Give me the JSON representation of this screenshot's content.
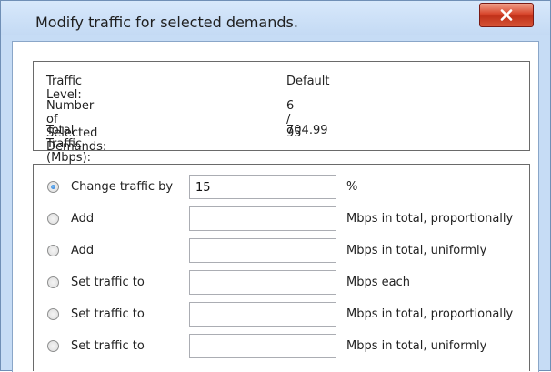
{
  "window": {
    "title": "Modify traffic for selected demands."
  },
  "info": [
    {
      "label": "Traffic Level:",
      "value": "Default"
    },
    {
      "label": "Number of Selected Demands:",
      "value": "6 / 95"
    },
    {
      "label": "Total Traffic (Mbps):",
      "value": "704.99"
    }
  ],
  "options": [
    {
      "label": "Change traffic by",
      "value": "15",
      "unit": "%",
      "selected": true
    },
    {
      "label": "Add",
      "value": "",
      "unit": "Mbps in total, proportionally",
      "selected": false
    },
    {
      "label": "Add",
      "value": "",
      "unit": "Mbps in total, uniformly",
      "selected": false
    },
    {
      "label": "Set traffic to",
      "value": "",
      "unit": "Mbps each",
      "selected": false
    },
    {
      "label": "Set traffic to",
      "value": "",
      "unit": "Mbps in total, proportionally",
      "selected": false
    },
    {
      "label": "Set traffic to",
      "value": "",
      "unit": "Mbps in total, uniformly",
      "selected": false
    }
  ],
  "colors": {
    "title_bar": "#c6dcf5",
    "close_button": "#d04a2e",
    "radio_selected": "#1a6ad0"
  }
}
